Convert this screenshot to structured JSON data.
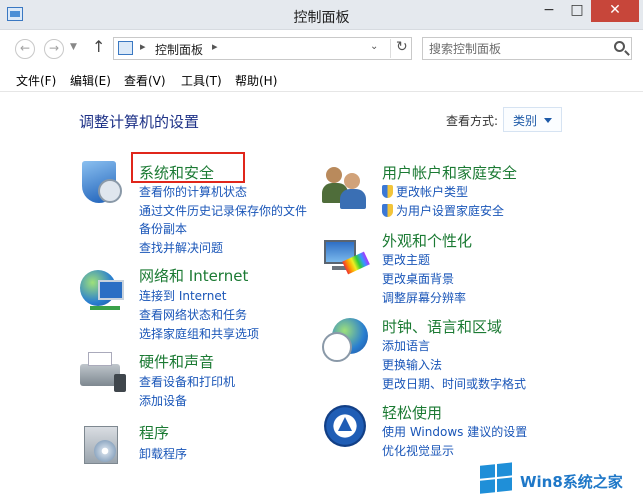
{
  "window": {
    "title": "控制面板",
    "minimize": "−",
    "maximize": "□",
    "close": "✕"
  },
  "address": {
    "back": "←",
    "forward": "→",
    "up": "↑",
    "separator": "▸",
    "crumb": "控制面板",
    "dropdown": "⌄",
    "refresh": "↻",
    "search_placeholder": "搜索控制面板"
  },
  "menu": {
    "items": [
      "文件(F)",
      "编辑(E)",
      "查看(V)",
      "工具(T)",
      "帮助(H)"
    ]
  },
  "content": {
    "heading": "调整计算机的设置",
    "view_by_label": "查看方式:",
    "view_by_value": "类别"
  },
  "categories": {
    "security": {
      "title": "系统和安全",
      "links": [
        "查看你的计算机状态",
        "通过文件历史记录保存你的文件",
        "备份副本",
        "查找并解决问题"
      ]
    },
    "network": {
      "title": "网络和 Internet",
      "links": [
        "连接到 Internet",
        "查看网络状态和任务",
        "选择家庭组和共享选项"
      ]
    },
    "hardware": {
      "title": "硬件和声音",
      "links": [
        "查看设备和打印机",
        "添加设备"
      ]
    },
    "programs": {
      "title": "程序",
      "links": [
        "卸载程序"
      ]
    },
    "users": {
      "title": "用户帐户和家庭安全",
      "links": [
        "更改帐户类型",
        "为用户设置家庭安全"
      ]
    },
    "appearance": {
      "title": "外观和个性化",
      "links": [
        "更改主题",
        "更改桌面背景",
        "调整屏幕分辨率"
      ]
    },
    "clock": {
      "title": "时钟、语言和区域",
      "links": [
        "添加语言",
        "更换输入法",
        "更改日期、时间或数字格式"
      ]
    },
    "ease": {
      "title": "轻松使用",
      "links": [
        "使用 Windows 建议的设置",
        "优化视觉显示"
      ]
    }
  },
  "watermark": {
    "text": "Win8系统之家"
  },
  "colors": {
    "category_title": "#1b7a33",
    "link": "#1a56b8",
    "heading": "#1e3287",
    "highlight": "#e0261b"
  }
}
